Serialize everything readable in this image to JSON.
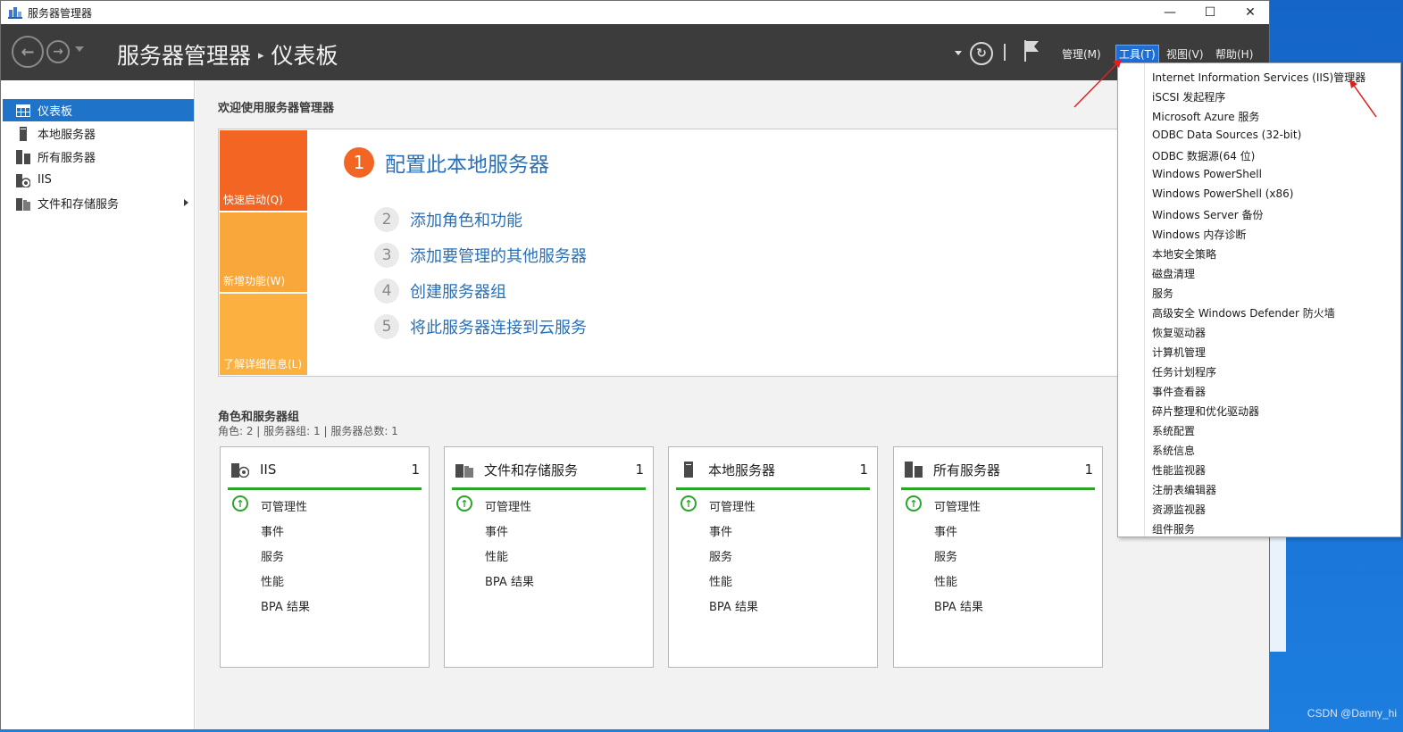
{
  "window": {
    "title": "服务器管理器",
    "minimize_glyph": "—",
    "maximize_glyph": "☐",
    "close_glyph": "✕"
  },
  "header": {
    "breadcrumb_root": "服务器管理器",
    "breadcrumb_sep": "▸",
    "breadcrumb_current": "仪表板",
    "menus": {
      "manage": "管理(M)",
      "tools": "工具(T)",
      "view": "视图(V)",
      "help": "帮助(H)"
    }
  },
  "sidebar": {
    "items": [
      {
        "label": "仪表板",
        "icon": "dashboard-icon"
      },
      {
        "label": "本地服务器",
        "icon": "server-icon"
      },
      {
        "label": "所有服务器",
        "icon": "servers-icon"
      },
      {
        "label": "IIS",
        "icon": "iis-icon"
      },
      {
        "label": "文件和存储服务",
        "icon": "storage-icon"
      }
    ]
  },
  "welcome": {
    "heading": "欢迎使用服务器管理器",
    "tiles": {
      "quick_start": "快速启动(Q)",
      "whats_new": "新增功能(W)",
      "learn_more": "了解详细信息(L)"
    },
    "steps": [
      {
        "num": "1",
        "label": "配置此本地服务器"
      },
      {
        "num": "2",
        "label": "添加角色和功能"
      },
      {
        "num": "3",
        "label": "添加要管理的其他服务器"
      },
      {
        "num": "4",
        "label": "创建服务器组"
      },
      {
        "num": "5",
        "label": "将此服务器连接到云服务"
      }
    ]
  },
  "roles": {
    "heading": "角色和服务器组",
    "summary": "角色: 2 | 服务器组: 1 | 服务器总数: 1",
    "cards": [
      {
        "name": "IIS",
        "count": "1",
        "rows": [
          "可管理性",
          "事件",
          "服务",
          "性能",
          "BPA 结果"
        ]
      },
      {
        "name": "文件和存储服务",
        "count": "1",
        "rows": [
          "可管理性",
          "事件",
          "性能",
          "BPA 结果"
        ]
      },
      {
        "name": "本地服务器",
        "count": "1",
        "rows": [
          "可管理性",
          "事件",
          "服务",
          "性能",
          "BPA 结果"
        ]
      },
      {
        "name": "所有服务器",
        "count": "1",
        "rows": [
          "可管理性",
          "事件",
          "服务",
          "性能",
          "BPA 结果"
        ]
      }
    ]
  },
  "tools_menu": {
    "items": [
      "Internet Information Services (IIS)管理器",
      "iSCSI 发起程序",
      "Microsoft Azure 服务",
      "ODBC Data Sources (32-bit)",
      "ODBC 数据源(64 位)",
      "Windows PowerShell",
      "Windows PowerShell (x86)",
      "Windows Server 备份",
      "Windows 内存诊断",
      "本地安全策略",
      "磁盘清理",
      "服务",
      "高级安全 Windows Defender 防火墙",
      "恢复驱动器",
      "计算机管理",
      "任务计划程序",
      "事件查看器",
      "碎片整理和优化驱动器",
      "系统配置",
      "系统信息",
      "性能监视器",
      "注册表编辑器",
      "资源监视器",
      "组件服务"
    ]
  },
  "watermark": "CSDN @Danny_hi",
  "colors": {
    "header_bg": "#3c3c3c",
    "accent": "#1f73c9",
    "quick_start": "#f26522",
    "tile_yellow": "#fbb040",
    "link": "#2a70b8",
    "status_green": "#2aa52a",
    "annotation_red": "#e02020"
  }
}
